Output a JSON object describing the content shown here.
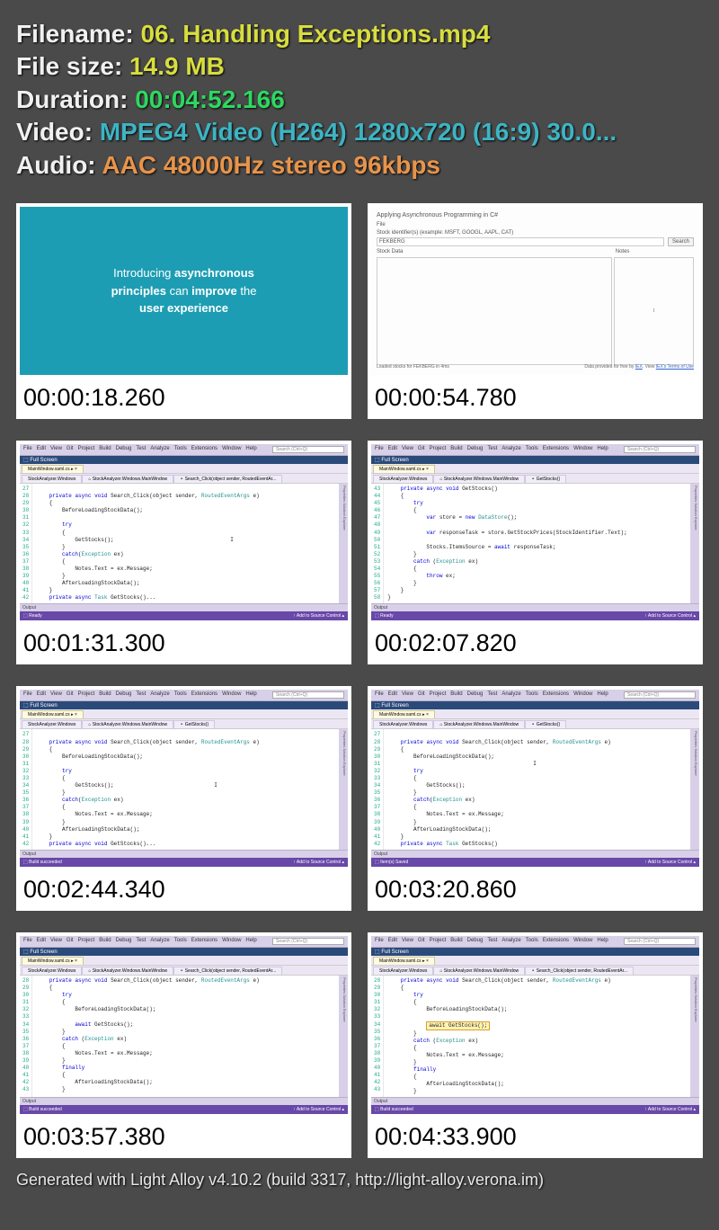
{
  "info": {
    "filename_label": "Filename: ",
    "filename_value": "06. Handling Exceptions.mp4",
    "filesize_label": "File size: ",
    "filesize_value": "14.9 MB",
    "duration_label": "Duration: ",
    "duration_value": "00:04:52.166",
    "video_label": "Video: ",
    "video_value": "MPEG4 Video (H264) 1280x720 (16:9) 30.0...",
    "audio_label": "Audio: ",
    "audio_value": "AAC 48000Hz stereo 96kbps"
  },
  "thumbs": [
    {
      "ts": "00:00:18.260"
    },
    {
      "ts": "00:00:54.780"
    },
    {
      "ts": "00:01:31.300"
    },
    {
      "ts": "00:02:07.820"
    },
    {
      "ts": "00:02:44.340"
    },
    {
      "ts": "00:03:20.860"
    },
    {
      "ts": "00:03:57.380"
    },
    {
      "ts": "00:04:33.900"
    }
  ],
  "slide1": {
    "line1a": "Introducing ",
    "line1b": "asynchronous",
    "line2a": "principles",
    "line2b": " can ",
    "line2c": "improve",
    "line2d": " the",
    "line3": "user experience"
  },
  "appwin": {
    "title": "Applying Asynchronous Programming in C#",
    "file_menu": "File",
    "label": "Stock identifier(s) (example: MSFT, GOOGL, AAPL, CAT)",
    "input": "FEKBERG",
    "search": "Search",
    "col1": "Stock Data",
    "col2": "Notes",
    "cursor": "I",
    "foot_left": "Loaded stocks for FEKBERG in 4ms",
    "foot_right_a": "Data provided for free by ",
    "foot_right_b": "IEX",
    "foot_right_c": ". View ",
    "foot_right_d": "IEX's Terms of Use"
  },
  "vs": {
    "menu": [
      "File",
      "Edit",
      "View",
      "Git",
      "Project",
      "Build",
      "Debug",
      "Test",
      "Analyze",
      "Tools",
      "Extensions",
      "Window",
      "Help"
    ],
    "search_ph": "Search (Ctrl+Q)",
    "fullscreen": "Full Screen",
    "tab_main": "MainWindow.xaml.cs",
    "tab_ns": "StockAnalyzer.Windows",
    "tab_cls": "StockAnalyzer.Windows.MainWindow",
    "tab_m1": "Search_Click(object sender, RoutedEventAr...",
    "tab_m2": "GetStocks()",
    "output": "Output",
    "status_ready": "Ready",
    "status_build": "Build succeeded",
    "status_saved": "Item(s) Saved",
    "status_right": "↑ Add to Source Control ▴"
  },
  "code3": {
    "lines": [
      "27",
      "28",
      "29",
      "30",
      "31",
      "32",
      "33",
      "34",
      "35",
      "36",
      "37",
      "38",
      "39",
      "40",
      "41",
      "42"
    ],
    "body": "\n    private async void Search_Click(object sender, RoutedEventArgs e)\n    {\n        BeforeLoadingStockData();\n\n        try\n        {\n            GetStocks();                                    I\n        }\n        catch(Exception ex)\n        {\n            Notes.Text = ex.Message;\n        }\n        AfterLoadingStockData();\n    }\n    private async Task GetStocks()..."
  },
  "code4": {
    "lines": [
      "43",
      "44",
      "45",
      "46",
      "47",
      "48",
      "49",
      "50",
      "51",
      "52",
      "53",
      "54",
      "55",
      "56",
      "57",
      "58"
    ],
    "body": "    private async void GetStocks()\n    {\n        try\n        {\n            var store = new DataStore();\n\n            var responseTask = store.GetStockPrices(StockIdentifier.Text);\n\n            Stocks.ItemsSource = await responseTask;\n        }\n        catch (Exception ex)\n        {\n            throw ex;\n        }\n    }\n}"
  },
  "code5": {
    "lines": [
      "27",
      "28",
      "29",
      "30",
      "31",
      "32",
      "33",
      "34",
      "35",
      "36",
      "37",
      "38",
      "39",
      "40",
      "41",
      "42"
    ],
    "body": "\n    private async void Search_Click(object sender, RoutedEventArgs e)\n    {\n        BeforeLoadingStockData();\n\n        try\n        {\n            GetStocks();                               I\n        }\n        catch(Exception ex)\n        {\n            Notes.Text = ex.Message;\n        }\n        AfterLoadingStockData();\n    }\n    private async void GetStocks()..."
  },
  "code6": {
    "lines": [
      "27",
      "28",
      "29",
      "30",
      "31",
      "32",
      "33",
      "34",
      "35",
      "36",
      "37",
      "38",
      "39",
      "40",
      "41",
      "42"
    ],
    "body": "\n    private async void Search_Click(object sender, RoutedEventArgs e)\n    {\n        BeforeLoadingStockData();\n                                             I\n        try\n        {\n            GetStocks();\n        }\n        catch(Exception ex)\n        {\n            Notes.Text = ex.Message;\n        }\n        AfterLoadingStockData();\n    }\n    private async Task GetStocks()"
  },
  "code7": {
    "lines": [
      "28",
      "29",
      "30",
      "31",
      "32",
      "33",
      "34",
      "35",
      "36",
      "37",
      "38",
      "39",
      "40",
      "41",
      "42",
      "43"
    ],
    "body": "    private async void Search_Click(object sender, RoutedEventArgs e)\n    {\n        try\n        {\n            BeforeLoadingStockData();\n\n            await GetStocks();\n        }\n        catch (Exception ex)\n        {\n            Notes.Text = ex.Message;\n        }\n        finally\n        {\n            AfterLoadingStockData();\n        }"
  },
  "code8": {
    "lines": [
      "28",
      "29",
      "30",
      "31",
      "32",
      "33",
      "34",
      "35",
      "36",
      "37",
      "38",
      "39",
      "40",
      "41",
      "42",
      "43"
    ],
    "body": "    private async void Search_Click(object sender, RoutedEventArgs e)\n    {\n        try\n        {\n            BeforeLoadingStockData();\n\n            [HL]await GetStocks();[/HL]\n        }\n        catch (Exception ex)\n        {\n            Notes.Text = ex.Message;\n        }\n        finally\n        {\n            AfterLoadingStockData();\n        }"
  },
  "footer": "Generated with Light Alloy v4.10.2 (build 3317, http://light-alloy.verona.im)"
}
